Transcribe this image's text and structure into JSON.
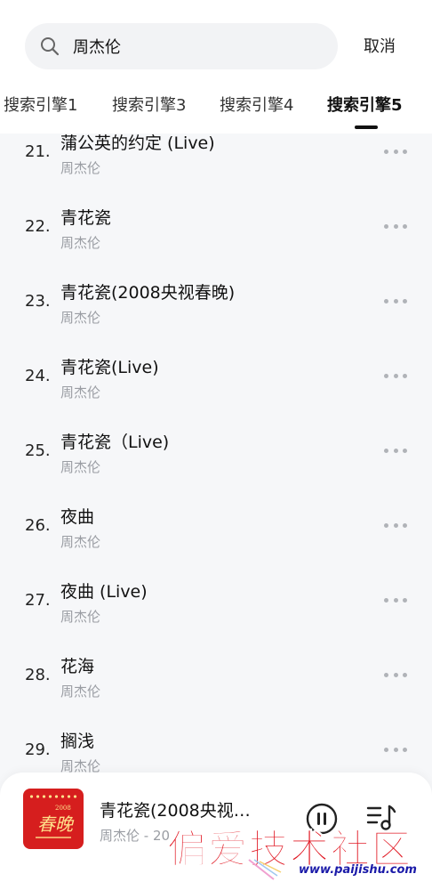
{
  "search": {
    "value": "周杰伦",
    "cancel_label": "取消"
  },
  "tabs": [
    {
      "label": "搜索引擎1",
      "active": false
    },
    {
      "label": "搜索引擎3",
      "active": false
    },
    {
      "label": "搜索引擎4",
      "active": false
    },
    {
      "label": "搜索引擎5",
      "active": true
    }
  ],
  "songs": [
    {
      "num": "21.",
      "title": "蒲公英的约定 (Live)",
      "artist": "周杰伦"
    },
    {
      "num": "22.",
      "title": "青花瓷",
      "artist": "周杰伦"
    },
    {
      "num": "23.",
      "title": "青花瓷(2008央视春晚)",
      "artist": "周杰伦"
    },
    {
      "num": "24.",
      "title": "青花瓷(Live)",
      "artist": "周杰伦"
    },
    {
      "num": "25.",
      "title": "青花瓷（Live)",
      "artist": "周杰伦"
    },
    {
      "num": "26.",
      "title": "夜曲",
      "artist": "周杰伦"
    },
    {
      "num": "27.",
      "title": "夜曲 (Live)",
      "artist": "周杰伦"
    },
    {
      "num": "28.",
      "title": "花海",
      "artist": "周杰伦"
    },
    {
      "num": "29.",
      "title": "搁浅",
      "artist": "周杰伦"
    }
  ],
  "now_playing": {
    "title": "青花瓷(2008央视…",
    "subtitle": "周杰伦 - 20",
    "cover_year": "2008",
    "cover_script": "春晚"
  },
  "watermark": {
    "text": "偏爱技术社区",
    "url": "www.paijishu.com"
  },
  "colors": {
    "background": "#f6f7f9",
    "accent": "#111111",
    "secondary_text": "#9a9da3",
    "watermark_red": "#e0141f"
  }
}
